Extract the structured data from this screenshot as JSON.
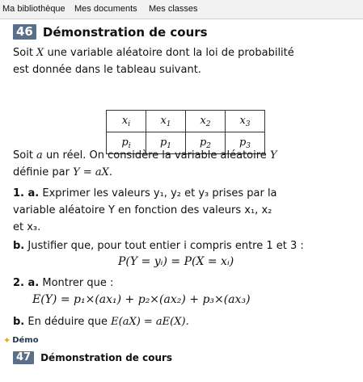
{
  "tabs": [
    "Ma bibliothèque",
    "Mes documents",
    "Mes classes"
  ],
  "section": {
    "number": "46",
    "title": "Démonstration de cours"
  },
  "intro": {
    "line1_a": "Soit ",
    "line1_var": "X",
    "line1_b": " une variable aléatoire dont la loi de probabilité",
    "line2": "est donnée dans le tableau suivant."
  },
  "table": {
    "row1": [
      "x_i",
      "x_1",
      "x_2",
      "x_3"
    ],
    "row2": [
      "p_i",
      "p_1",
      "p_2",
      "p_3"
    ]
  },
  "text2": {
    "line1_a": "Soit ",
    "line1_var": "a",
    "line1_b": " un réel. On considère la variable aléatoire ",
    "line1_var2": "Y",
    "line2_a": "définie par ",
    "line2_eq": "Y = aX",
    "line2_b": "."
  },
  "q1a": {
    "label": "1. a.",
    "line1": " Exprimer les valeurs y₁, y₂ et y₃ prises par la",
    "line2": "variable aléatoire Y en fonction des valeurs x₁, x₂",
    "line3": "et x₃."
  },
  "q1b": {
    "label": "b.",
    "line1": " Justifier que, pour tout entier i compris entre 1 et 3 :",
    "formula": "P(Y = yᵢ) = P(X = xᵢ)"
  },
  "q2a": {
    "label": "2. a.",
    "line1": " Montrer que :",
    "formula": "E(Y) = p₁×(ax₁) + p₂×(ax₂) + p₃×(ax₃)"
  },
  "q2b": {
    "label": "b.",
    "line1": " En déduire que ",
    "formula": "E(aX) = aE(X)."
  },
  "footer": {
    "demo_tag": "Démo",
    "next_number": "47",
    "next_title": "Démonstration de cours"
  },
  "colors": {
    "badge": "#5b6f88",
    "tab_bg": "#f2f2f2",
    "star": "#e2a81a"
  }
}
